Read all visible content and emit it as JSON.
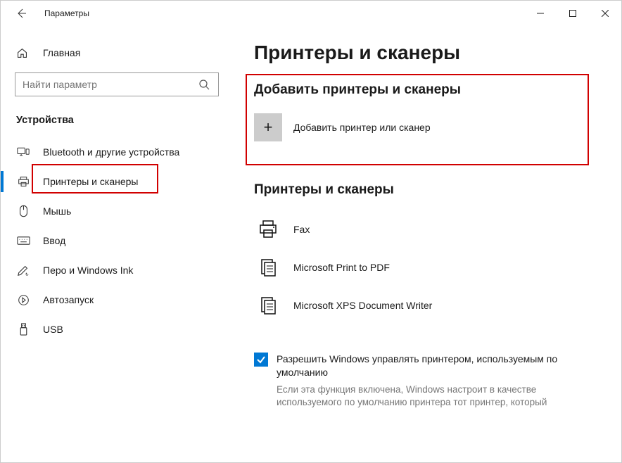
{
  "titlebar": {
    "app_title": "Параметры"
  },
  "sidebar": {
    "home_label": "Главная",
    "search_placeholder": "Найти параметр",
    "category": "Устройства",
    "items": [
      {
        "label": "Bluetooth и другие устройства"
      },
      {
        "label": "Принтеры и сканеры"
      },
      {
        "label": "Мышь"
      },
      {
        "label": "Ввод"
      },
      {
        "label": "Перо и Windows Ink"
      },
      {
        "label": "Автозапуск"
      },
      {
        "label": "USB"
      }
    ]
  },
  "main": {
    "page_title": "Принтеры и сканеры",
    "add_section_header": "Добавить принтеры и сканеры",
    "add_button_label": "Добавить принтер или сканер",
    "list_header": "Принтеры и сканеры",
    "printers": [
      {
        "name": "Fax"
      },
      {
        "name": "Microsoft Print to PDF"
      },
      {
        "name": "Microsoft XPS Document Writer"
      }
    ],
    "default_checkbox_label": "Разрешить Windows управлять принтером, используемым по умолчанию",
    "default_checkbox_desc": "Если эта функция включена, Windows настроит в качестве используемого по умолчанию принтера тот принтер, который"
  }
}
